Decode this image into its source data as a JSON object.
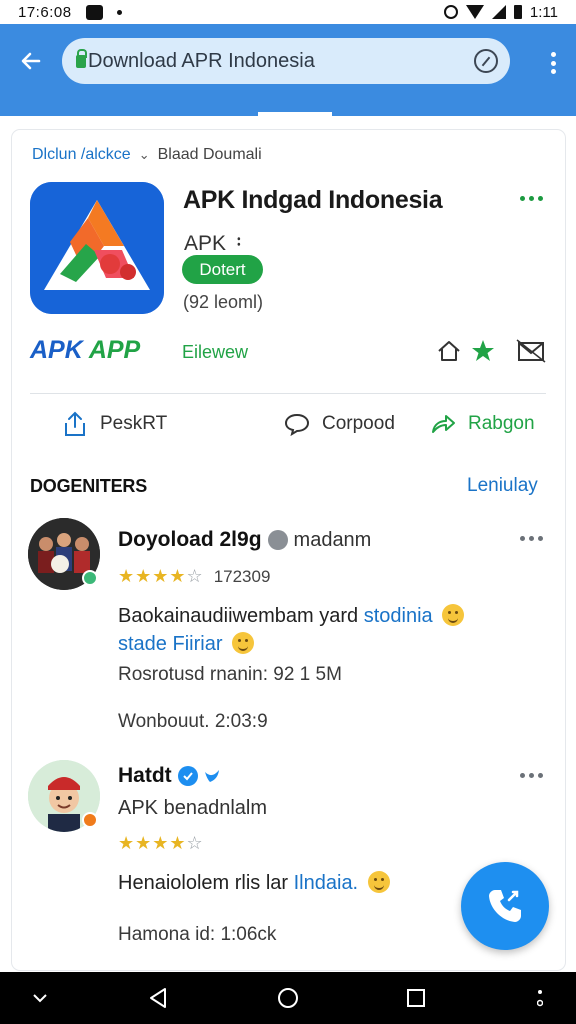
{
  "status_bar": {
    "time": "17:6:08",
    "clock": "1:11"
  },
  "browser": {
    "url": "Download APR Indonesia"
  },
  "breadcrumb": {
    "parent": "Dlclun /alckce",
    "current": "Blaad Doumali"
  },
  "app": {
    "title": "APK Indgad Indonesia",
    "subtitle": "APK ᠄",
    "install_label": "Dotert",
    "count": "(92 leoml)",
    "brand_a": "APK",
    "brand_b": "APP",
    "review_link": "Eilewew"
  },
  "actions": {
    "share": "PeskRT",
    "comment": "Corpood",
    "reshare": "Rabgon"
  },
  "section": {
    "title": "DOGENITERS",
    "link": "Leniulay"
  },
  "reviews": [
    {
      "name": "Doyoload 2l9g",
      "handle": "madanm",
      "rating": 4,
      "rating_count": "172309",
      "text_line1": "Baokainaudiiwembam yard",
      "text_line1_hl": "stodinia",
      "text_line2_hl": "stade Fiiriar",
      "meta1": "Rosrotusd rnanin:  92 1 5M",
      "meta2": "Wonbouut.  2:03:9"
    },
    {
      "name": "Hatdt",
      "handle": "APK benadnlalm",
      "rating": 4,
      "text_line1": "Henaiololem rlis lar",
      "text_line1_hl": "Ilndaia.",
      "meta1": "Hamona  id:  1:06ck"
    }
  ],
  "colors": {
    "app_bar": "#3b8be0",
    "accent_green": "#21a346",
    "link_blue": "#1a73c7",
    "fab": "#1e8ff0"
  }
}
